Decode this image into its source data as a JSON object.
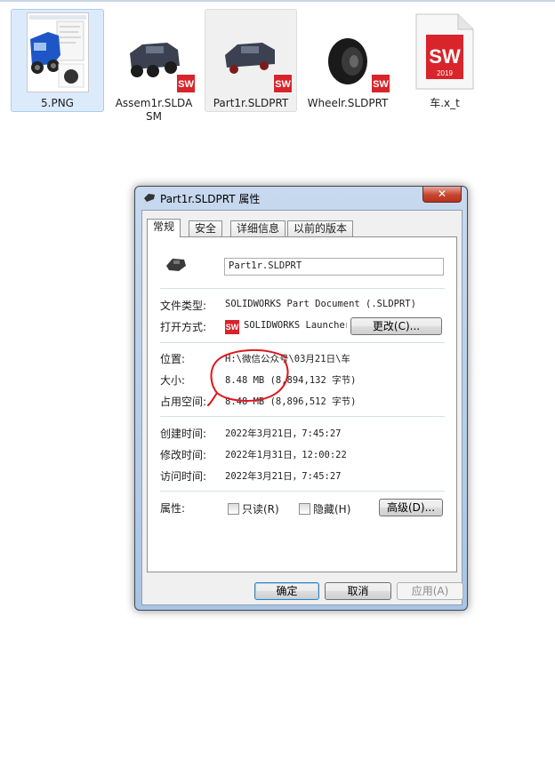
{
  "files": [
    {
      "name": "5.PNG"
    },
    {
      "name": "Assem1r.SLDASM"
    },
    {
      "name": "Part1r.SLDPRT"
    },
    {
      "name": "Wheelr.SLDPRT"
    },
    {
      "name": "车.x_t"
    }
  ],
  "icons": {
    "sw_badge": "SW",
    "sw_year": "2019"
  },
  "dialog": {
    "title": "Part1r.SLDPRT 属性",
    "close": "✕",
    "tabs": [
      "常规",
      "安全",
      "详细信息",
      "以前的版本"
    ],
    "general": {
      "filename": "Part1r.SLDPRT",
      "type_label": "文件类型:",
      "type_value": "SOLIDWORKS Part Document (.SLDPRT)",
      "open_label": "打开方式:",
      "open_value": "SOLIDWORKS Launcher",
      "change_button": "更改(C)...",
      "location_label": "位置:",
      "location_value": "H:\\微信公众号\\03月21日\\车",
      "size_label": "大小:",
      "size_value": "8.48 MB (8,894,132 字节)",
      "disk_label": "占用空间:",
      "disk_value": "8.48 MB (8,896,512 字节)",
      "created_label": "创建时间:",
      "created_value": "2022年3月21日，7:45:27",
      "modified_label": "修改时间:",
      "modified_value": "2022年1月31日，12:00:22",
      "accessed_label": "访问时间:",
      "accessed_value": "2022年3月21日，7:45:27",
      "attr_label": "属性:",
      "readonly_label": "只读(R)",
      "hidden_label": "隐藏(H)",
      "advanced_button": "高级(D)..."
    },
    "buttons": {
      "ok": "确定",
      "cancel": "取消",
      "apply": "应用(A)"
    }
  },
  "colors": {
    "selection": "#dcebfc",
    "annotation": "#e0161c",
    "solidworks_red": "#d8242a"
  }
}
